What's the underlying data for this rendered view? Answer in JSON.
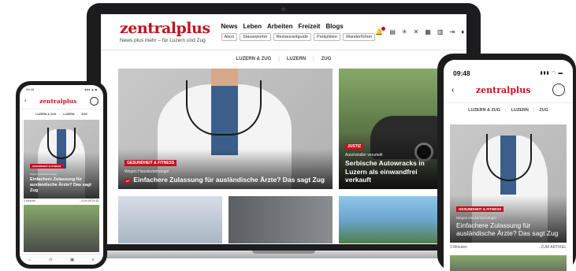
{
  "laptop": {
    "logo": "zentralplus",
    "tagline": "News plus mehr – für Luzern und Zug",
    "nav_main": [
      "News",
      "Leben",
      "Arbeiten",
      "Freizeit",
      "Blogs"
    ],
    "nav_sub": [
      "Abos",
      "Stauseporter",
      "Restaurantguide",
      "Parkplätze",
      "Wanderführer"
    ],
    "avatar_initials": "SB",
    "region_tabs": [
      "LUZERN & ZUG",
      "LUZERN",
      "ZUG"
    ],
    "hero": {
      "category": "GESUNDHEIT & FITNESS",
      "kicker": "Wegen Hausärztemangel",
      "headline": "Einfachere Zulassung für ausländische Ärzte? Das sagt Zug",
      "plus": "z+"
    },
    "side": {
      "category": "JUSTIZ",
      "kicker": "Autohändler verurteilt",
      "headline": "Serbische Autowracks in Luzern als einwandfrei verkauft"
    }
  },
  "phone_left": {
    "status_left": "09:48",
    "status_right": "●●● ▲ ■",
    "logo": "zentralplus",
    "region_tabs": [
      "LUZERN & ZUG",
      "LUZERN",
      "ZUG"
    ],
    "hero": {
      "category": "GESUNDHEIT & FITNESS",
      "kicker": "Wegen Hausärztemangel",
      "headline": "Einfachere Zulassung für ausländische Ärzte? Das sagt Zug"
    },
    "meta_left": "3 Minuten",
    "meta_right": "→ZUM ARTIKEL",
    "tabbar": [
      "⌂",
      "◷",
      "▣",
      "≡"
    ]
  },
  "phone_right": {
    "time": "09:48",
    "system_icons": "▮▮▮ ◠ ▬",
    "logo": "zentralplus",
    "region_tabs": [
      "LUZERN & ZUG",
      "LUZERN",
      "ZUG"
    ],
    "hero": {
      "category": "GESUNDHEIT & FITNESS",
      "kicker": "Wegen Hausärztemangel",
      "headline": "Einfachere Zulassung für ausländische Ärzte? Das sagt Zug"
    },
    "meta_left": "3 Minuten",
    "meta_right": "→ZUM ARTIKEL"
  },
  "colors": {
    "brand": "#c1121f",
    "avatar": "#2f8f3a"
  }
}
